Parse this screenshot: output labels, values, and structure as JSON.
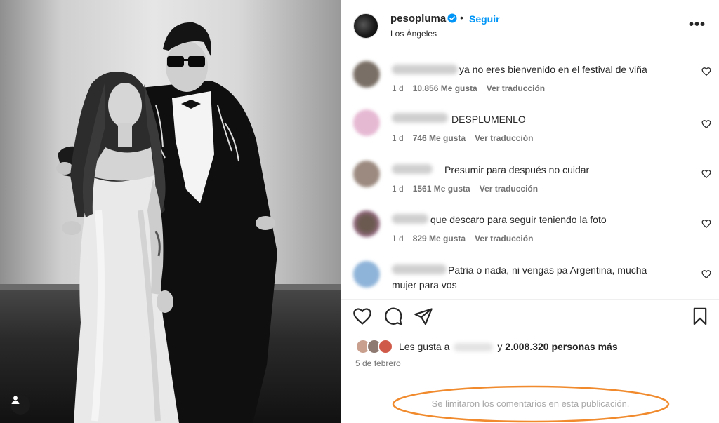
{
  "post": {
    "username": "pesopluma",
    "location": "Los Ángeles",
    "follow_label": "Seguir",
    "dot": "•",
    "more_label": "•••"
  },
  "comments": [
    {
      "text": "ya no eres bienvenido en el festival de viña",
      "time": "1 d",
      "likes": "10.856 Me gusta",
      "translate": "Ver traducción"
    },
    {
      "text": "DESPLUMENLO",
      "time": "1 d",
      "likes": "746 Me gusta",
      "translate": "Ver traducción"
    },
    {
      "text": "Presumir para después no cuidar",
      "time": "1 d",
      "likes": "1561 Me gusta",
      "translate": "Ver traducción"
    },
    {
      "text": "que descaro para seguir teniendo la foto",
      "time": "1 d",
      "likes": "829 Me gusta",
      "translate": "Ver traducción"
    },
    {
      "text_line1": "Patria o nada, ni vengas pa Argentina, mucha",
      "text_line2": "mujer para vos"
    }
  ],
  "likes": {
    "prefix": "Les gusta a",
    "suffix": "y",
    "count": "2.008.320 personas más"
  },
  "date": "5 de febrero",
  "comments_limited": "Se limitaron los comentarios en esta publicación.",
  "icons": [
    "verified-badge-icon",
    "more-options-icon",
    "heart-icon",
    "comment-icon",
    "share-icon",
    "bookmark-icon",
    "user-tag-icon"
  ],
  "colors": {
    "link_blue": "#0095f6",
    "text": "#262626",
    "secondary_text": "#737373",
    "disabled_text": "#a8a8a8",
    "highlight_ellipse": "#f08a2c"
  }
}
